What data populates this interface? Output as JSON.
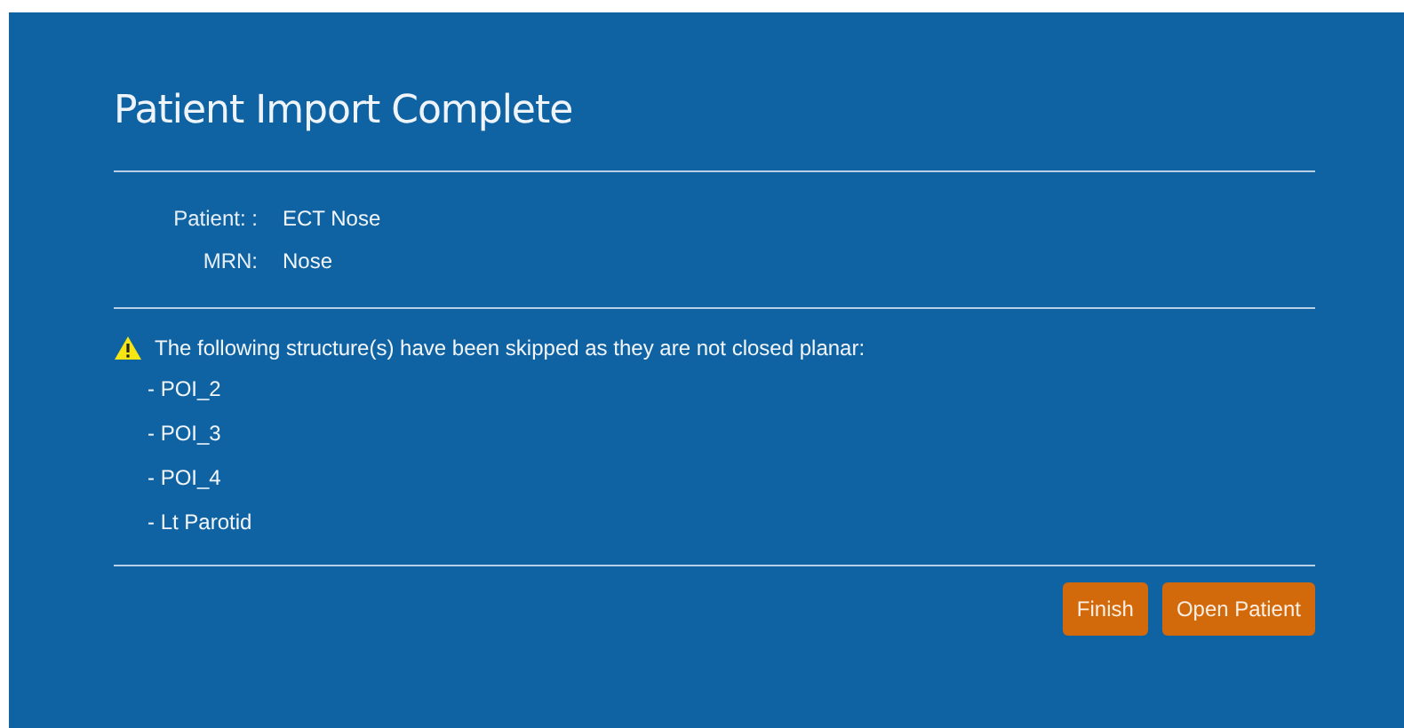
{
  "dialog": {
    "title": "Patient Import Complete",
    "fields": [
      {
        "label": "Patient: :",
        "value": "ECT Nose"
      },
      {
        "label": "MRN:",
        "value": "Nose"
      }
    ],
    "warning": {
      "message": "The following structure(s) have been skipped as they are not closed planar:",
      "items": [
        "- POI_2",
        "- POI_3",
        "- POI_4",
        "- Lt Parotid"
      ]
    },
    "buttons": [
      "Finish",
      "Open Patient"
    ]
  }
}
